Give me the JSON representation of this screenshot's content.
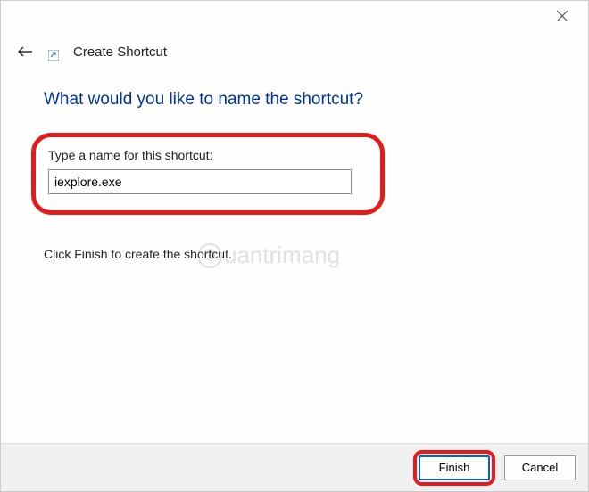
{
  "window": {
    "title": "Create Shortcut"
  },
  "page": {
    "heading": "What would you like to name the shortcut?",
    "label": "Type a name for this shortcut:",
    "input_value": "iexplore.exe",
    "instruction": "Click Finish to create the shortcut."
  },
  "buttons": {
    "finish": "Finish",
    "cancel": "Cancel"
  },
  "watermark": "uantrimang"
}
